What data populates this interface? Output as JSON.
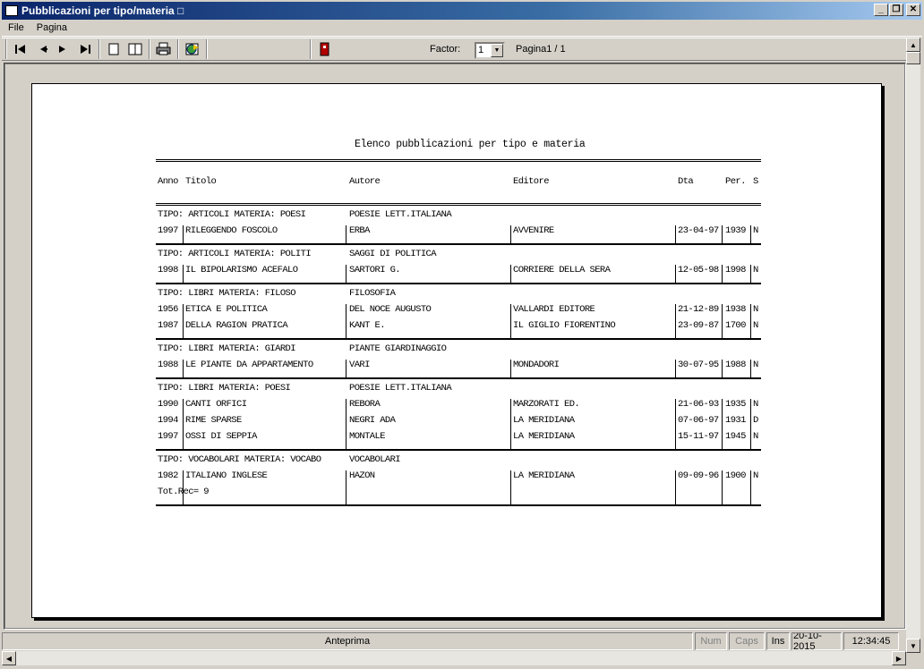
{
  "window": {
    "title": "Pubblicazioni per tipo/materia □"
  },
  "menu": {
    "items": [
      "File",
      "Pagina"
    ]
  },
  "toolbar": {
    "factor_label": "Factor:",
    "factor_value": "1",
    "page_label": "Pagina1 / 1"
  },
  "report": {
    "title": "Elenco pubblicazioni per tipo e materia",
    "headers": [
      "Anno",
      "Titolo",
      "Autore",
      "Editore",
      "Dta",
      "Per.",
      "S"
    ],
    "groups": [
      {
        "tipo": "TIPO: ARTICOLI    MATERIA: POESI",
        "materia": "POESIE LETT.ITALIANA",
        "rows": [
          [
            "1997",
            "RILEGGENDO FOSCOLO",
            "ERBA",
            "AVVENIRE",
            "23-04-97",
            "1939",
            "N"
          ]
        ]
      },
      {
        "tipo": "TIPO: ARTICOLI    MATERIA: POLITI",
        "materia": "SAGGI DI POLITICA",
        "rows": [
          [
            "1998",
            "IL BIPOLARISMO ACEFALO",
            "SARTORI G.",
            "CORRIERE DELLA SERA",
            "12-05-98",
            "1998",
            "N"
          ]
        ]
      },
      {
        "tipo": "TIPO: LIBRI       MATERIA: FILOSO",
        "materia": "FILOSOFIA",
        "rows": [
          [
            "1956",
            "ETICA E POLITICA",
            "DEL NOCE AUGUSTO",
            "VALLARDI EDITORE",
            "21-12-89",
            "1938",
            "N"
          ],
          [
            "1987",
            "DELLA RAGION PRATICA",
            "KANT E.",
            "IL GIGLIO FIORENTINO",
            "23-09-87",
            "1700",
            "N"
          ]
        ]
      },
      {
        "tipo": "TIPO: LIBRI       MATERIA: GIARDI",
        "materia": "PIANTE GIARDINAGGIO",
        "rows": [
          [
            "1988",
            "LE PIANTE DA APPARTAMENTO",
            "VARI",
            "MONDADORI",
            "30-07-95",
            "1988",
            "N"
          ]
        ]
      },
      {
        "tipo": "TIPO: LIBRI       MATERIA: POESI",
        "materia": "POESIE LETT.ITALIANA",
        "rows": [
          [
            "1990",
            "CANTI ORFICI",
            "REBORA",
            "MARZORATI ED.",
            "21-06-93",
            "1935",
            "N"
          ],
          [
            "1994",
            "RIME SPARSE",
            "NEGRI ADA",
            "LA MERIDIANA",
            "07-06-97",
            "1931",
            "D"
          ],
          [
            "1997",
            "OSSI DI SEPPIA",
            "MONTALE",
            "LA MERIDIANA",
            "15-11-97",
            "1945",
            "N"
          ]
        ]
      },
      {
        "tipo": "TIPO: VOCABOLARI  MATERIA: VOCABO",
        "materia": "VOCABOLARI",
        "rows": [
          [
            "1982",
            "ITALIANO INGLESE",
            "HAZON",
            "LA MERIDIANA",
            "09-09-96",
            "1900",
            "N"
          ]
        ]
      }
    ],
    "total": "Tot.Rec= 9"
  },
  "status": {
    "main": "Anteprima",
    "num": "Num",
    "caps": "Caps",
    "ins": "Ins",
    "date": "20-10-2015",
    "time": "12:34:45"
  }
}
